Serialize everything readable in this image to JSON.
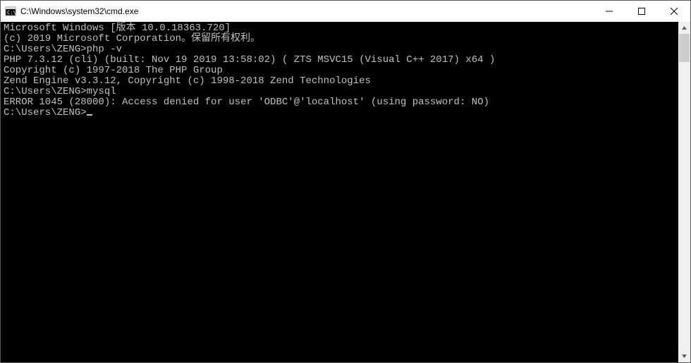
{
  "window": {
    "title": "C:\\Windows\\system32\\cmd.exe"
  },
  "terminal": {
    "lines": [
      "Microsoft Windows [版本 10.0.18363.720]",
      "(c) 2019 Microsoft Corporation。保留所有权利。",
      "",
      "C:\\Users\\ZENG>php -v",
      "PHP 7.3.12 (cli) (built: Nov 19 2019 13:58:02) ( ZTS MSVC15 (Visual C++ 2017) x64 )",
      "Copyright (c) 1997-2018 The PHP Group",
      "Zend Engine v3.3.12, Copyright (c) 1998-2018 Zend Technologies",
      "",
      "C:\\Users\\ZENG>mysql",
      "ERROR 1045 (28000): Access denied for user 'ODBC'@'localhost' (using password: NO)",
      "",
      "C:\\Users\\ZENG>"
    ]
  }
}
